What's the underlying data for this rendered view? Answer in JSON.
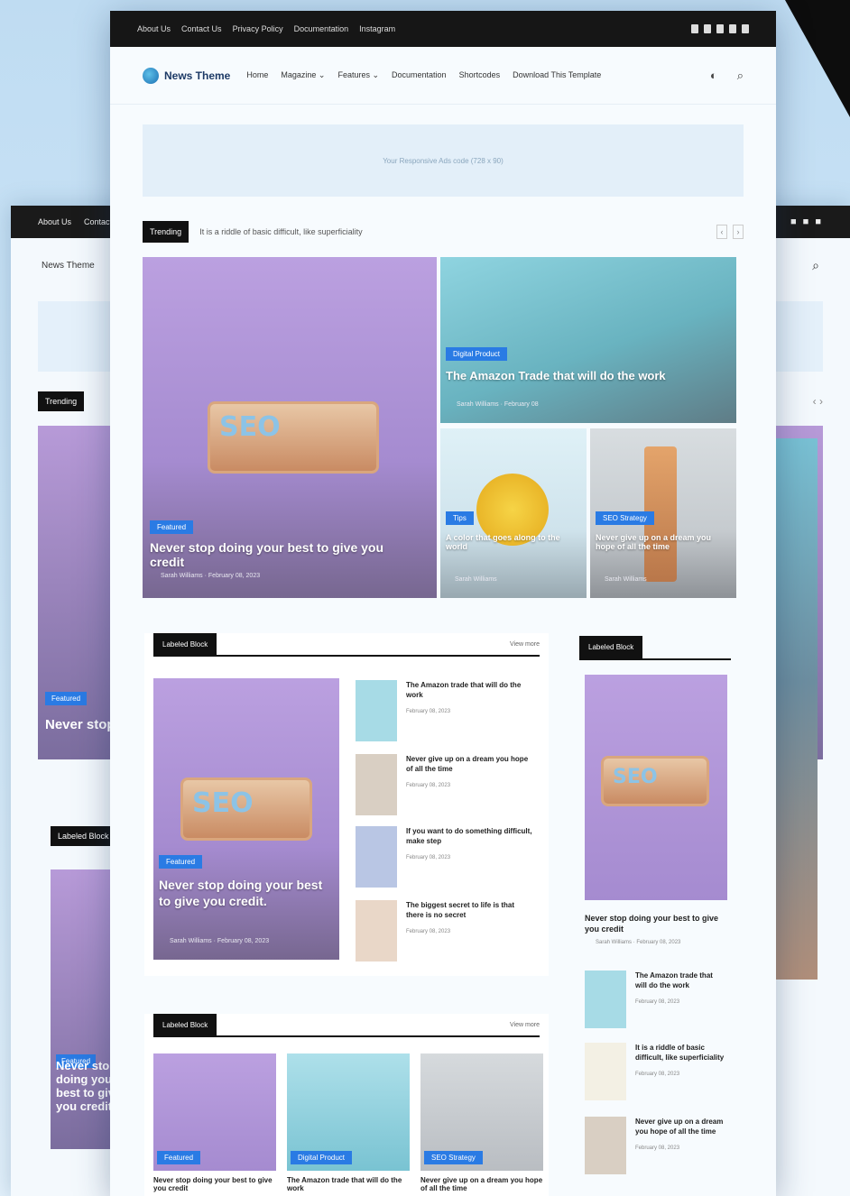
{
  "topbar": {
    "links": [
      "About Us",
      "Contact Us",
      "Privacy Policy",
      "Documentation",
      "Instagram"
    ]
  },
  "header": {
    "logo_text": "News Theme",
    "nav": [
      "Home",
      "Magazine ⌄",
      "Features ⌄",
      "Documentation",
      "Shortcodes",
      "Download This Template"
    ]
  },
  "ad_text": "Your Responsive Ads code (728 x 90)",
  "trending": {
    "label": "Trending",
    "headline": "It is a riddle of basic difficult, like superficiality"
  },
  "hero": {
    "main": {
      "category": "Featured",
      "title": "Never stop doing your best to give you credit",
      "meta": "Sarah Williams · February 08, 2023"
    },
    "top_right": {
      "category": "Digital Product",
      "title": "The Amazon Trade that will do the work",
      "meta": "Sarah Williams · February 08"
    },
    "bottom_left": {
      "category": "Tips",
      "title": "A color that goes along to the world",
      "meta": "Sarah Williams"
    },
    "bottom_right": {
      "category": "SEO Strategy",
      "title": "Never give up on a dream you hope of all the time",
      "meta": "Sarah Williams"
    }
  },
  "block1": {
    "label": "Labeled Block",
    "more": "View more",
    "main": {
      "category": "Featured",
      "title": "Never stop doing your best to give you credit.",
      "meta": "Sarah Williams · February 08, 2023"
    },
    "items": [
      {
        "title": "The Amazon trade that will do the work",
        "date": "February 08, 2023"
      },
      {
        "title": "Never give up on a dream you hope of all the time",
        "date": "February 08, 2023"
      },
      {
        "title": "If you want to do something difficult, make step",
        "date": "February 08, 2023"
      },
      {
        "title": "The biggest secret to life is that there is no secret",
        "date": "February 08, 2023"
      }
    ]
  },
  "sidebar": {
    "label": "Labeled Block",
    "main": {
      "title": "Never stop doing your best to give you credit",
      "meta": "Sarah Williams · February 08, 2023"
    },
    "items": [
      {
        "title": "The Amazon trade that will do the work",
        "date": "February 08, 2023"
      },
      {
        "title": "It is a riddle of basic difficult, like superficiality",
        "date": "February 08, 2023"
      },
      {
        "title": "Never give up on a dream you hope of all the time",
        "date": "February 08, 2023"
      }
    ]
  },
  "block2": {
    "label": "Labeled Block",
    "more": "View more",
    "cards": [
      {
        "category": "Featured",
        "title": "Never stop doing your best to give you credit"
      },
      {
        "category": "Digital Product",
        "title": "The Amazon trade that will do the work"
      },
      {
        "category": "SEO Strategy",
        "title": "Never give up on a dream you hope of all the time"
      }
    ]
  },
  "back": {
    "trending_label": "Trending",
    "block_label": "Labeled Block",
    "hero_category": "Featured",
    "hero_title": "Never stop doing your best to give you credit.",
    "block_title": "Never stop doing your best to give you credit"
  },
  "colors": {
    "accent": "#2a7be4",
    "dark": "#111111",
    "hero_purple": "#b79ad8"
  }
}
